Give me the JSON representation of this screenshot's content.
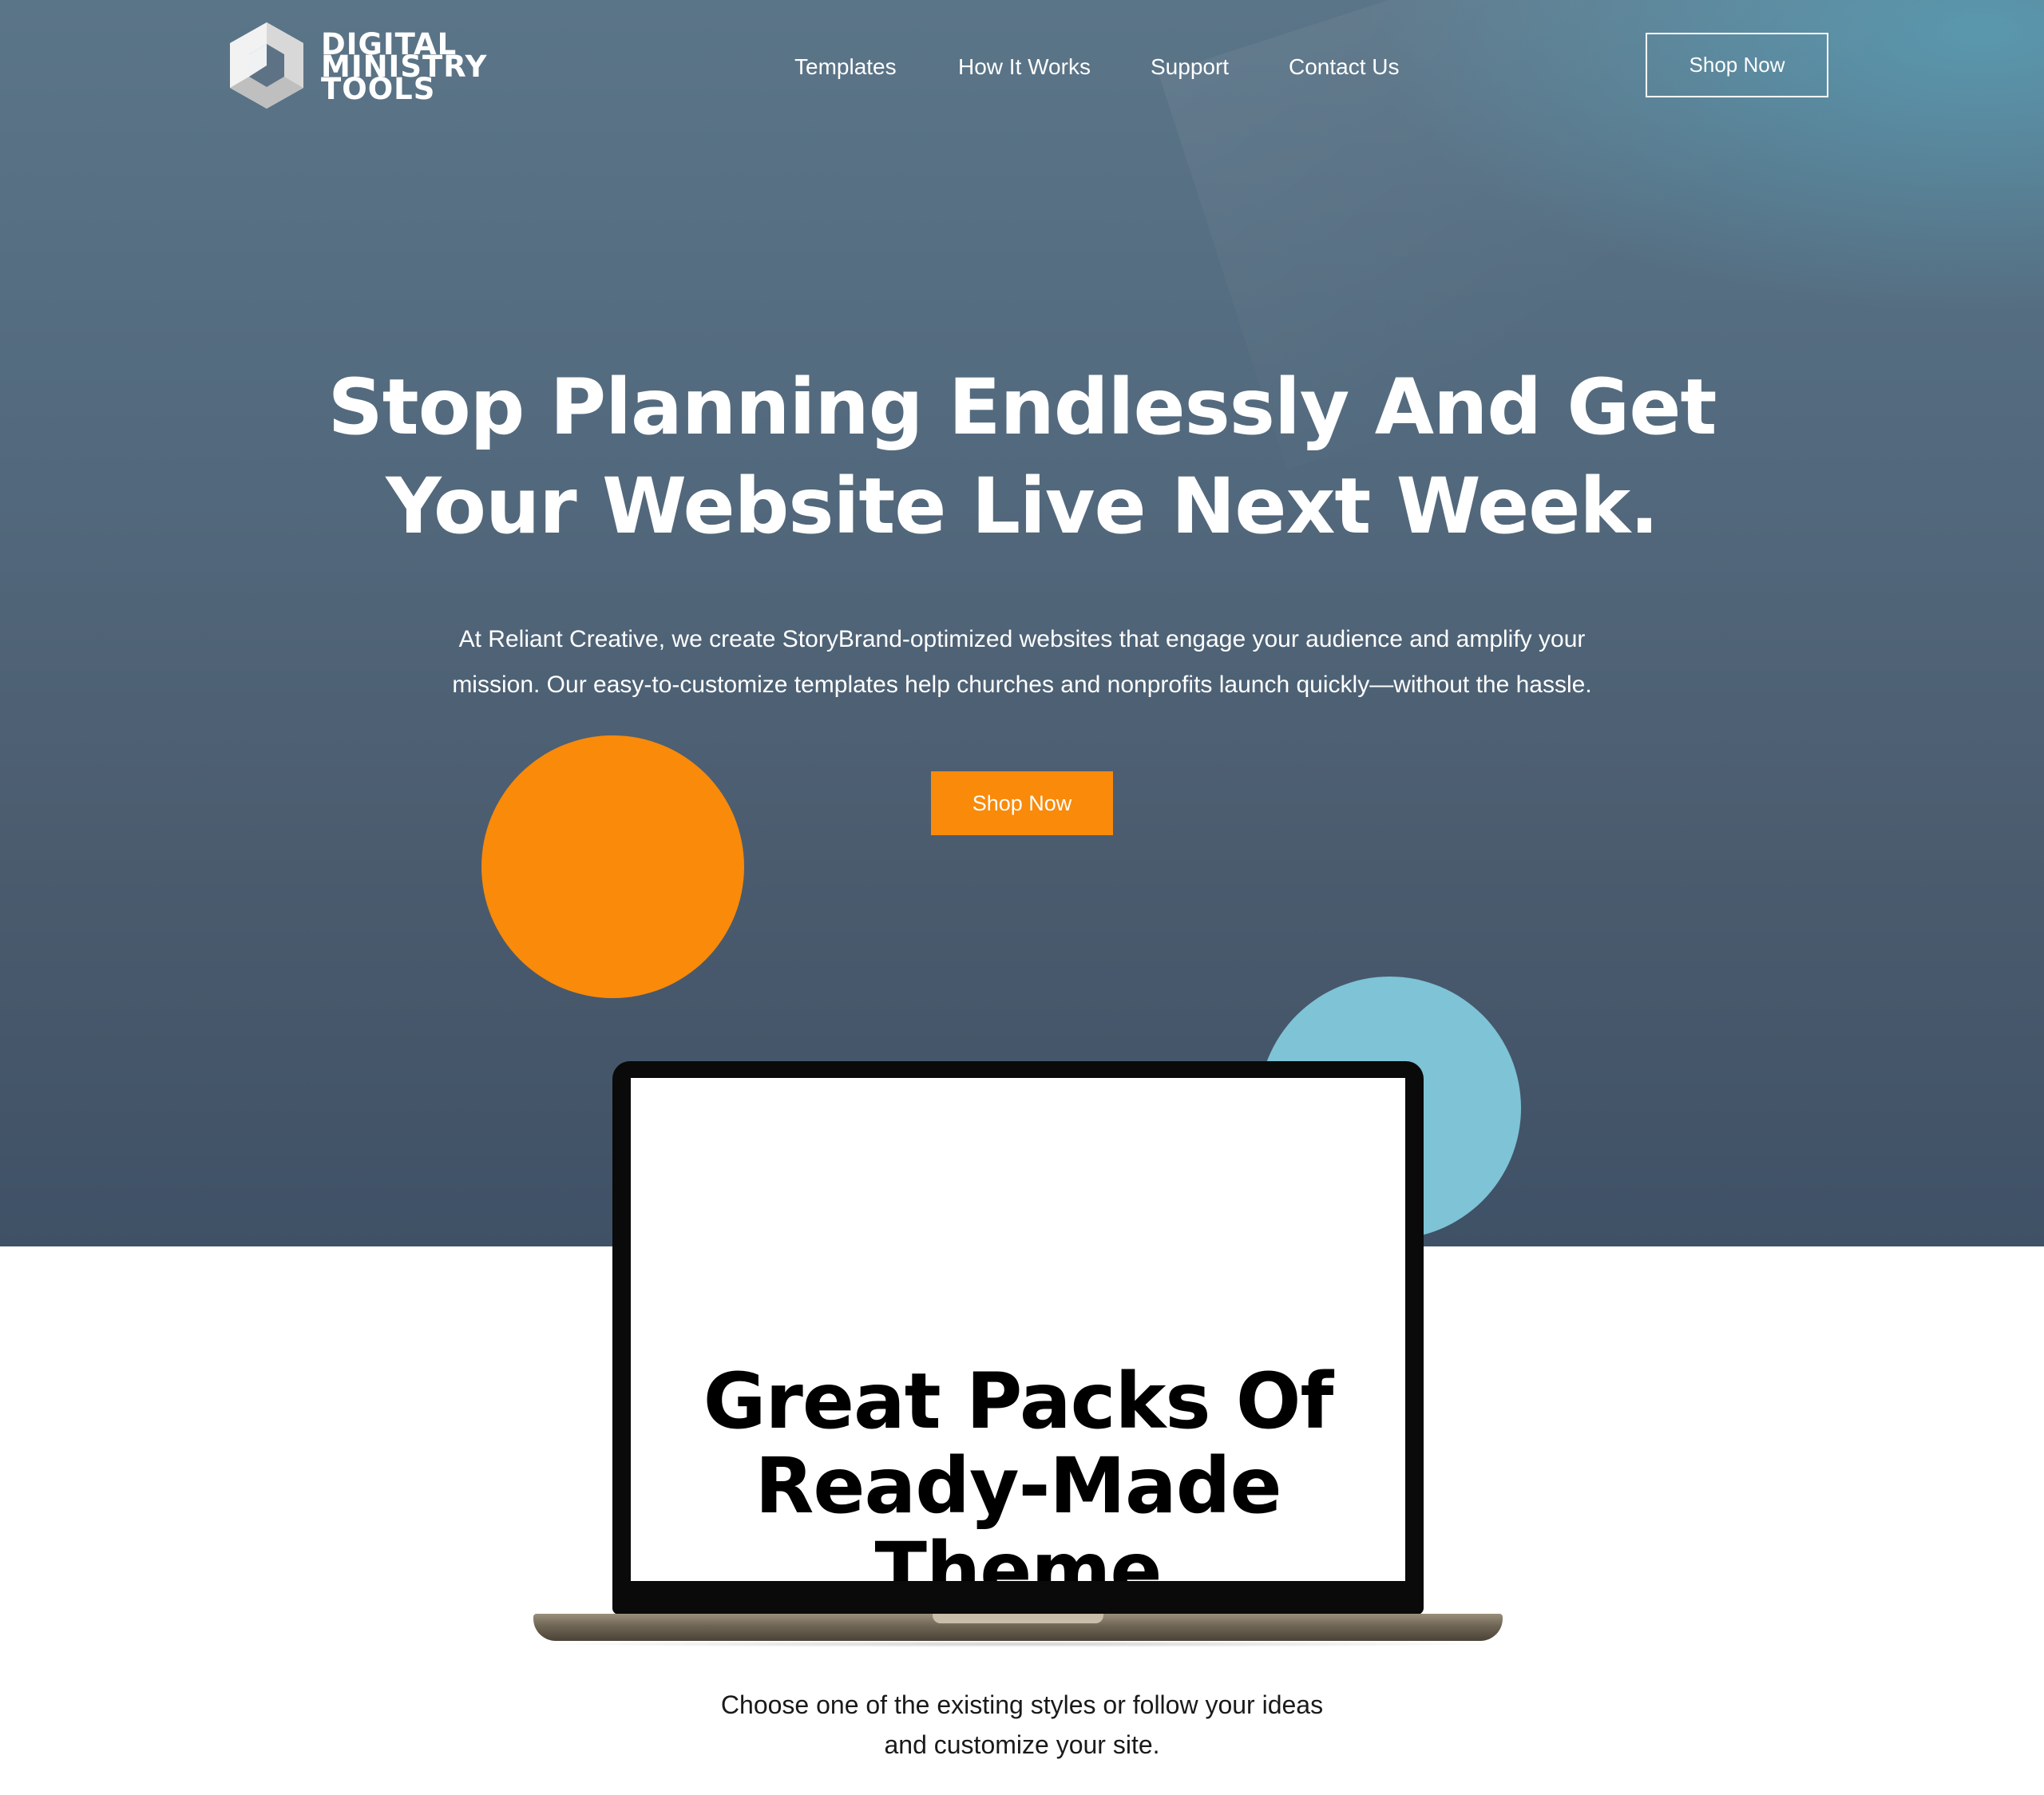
{
  "brand": {
    "logo_lines": [
      "DIGITAL",
      "MINISTRY",
      "TOOLS"
    ],
    "logo_icon": "hexagon-logo-icon"
  },
  "nav": {
    "items": [
      {
        "label": "Templates"
      },
      {
        "label": "How It Works"
      },
      {
        "label": "Support"
      },
      {
        "label": "Contact Us"
      }
    ],
    "cta_label": "Shop Now"
  },
  "hero": {
    "headline_line1": "Stop Planning Endlessly And Get",
    "headline_line2": "Your Website Live Next Week.",
    "subtext_line1": "At Reliant Creative, we create StoryBrand-optimized websites that engage your audience and amplify your",
    "subtext_line2": "mission. Our easy-to-customize templates help churches and nonprofits launch quickly—without the hassle.",
    "cta_label": "Shop Now"
  },
  "showcase": {
    "screen_line1": "Great Packs Of",
    "screen_line2": "Ready-Made",
    "screen_line3": "Theme",
    "caption_line1": "Choose one of the existing styles or follow your ideas",
    "caption_line2": "and customize your site."
  },
  "colors": {
    "accent_orange": "#f98a0a",
    "accent_blue": "#7ec3d6",
    "hero_bg": "#536a7e"
  }
}
